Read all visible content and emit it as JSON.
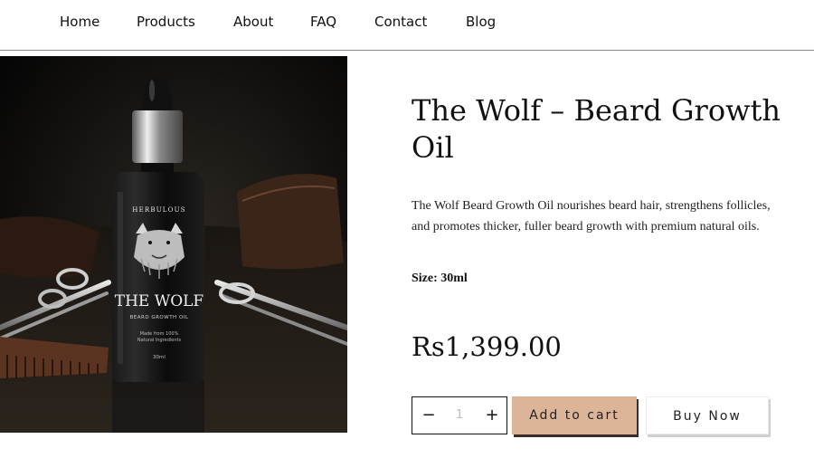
{
  "nav": {
    "items": [
      "Home",
      "Products",
      "About",
      "FAQ",
      "Contact",
      "Blog"
    ]
  },
  "product": {
    "image": {
      "bottle_brand": "HERBULOUS",
      "bottle_name": "THE WOLF",
      "bottle_subtitle": "BEARD GROWTH OIL",
      "bottle_note_1": "Made from 100%",
      "bottle_note_2": "Natural Ingredients",
      "bottle_volume": "30ml"
    },
    "title": "The Wolf – Beard Growth Oil",
    "description": "The Wolf Beard Growth Oil nourishes beard hair, strengthens follicles, and promotes thicker, fuller beard growth with premium natural oils.",
    "size": "Size: 30ml",
    "price": "Rs1,399.00"
  },
  "purchase": {
    "quantity": "1",
    "minus": "−",
    "plus": "+",
    "add_to_cart": "Add to cart",
    "buy_now": "Buy Now"
  },
  "colors": {
    "add_to_cart_bg": "#dcb498",
    "image_bg": "#070707"
  }
}
